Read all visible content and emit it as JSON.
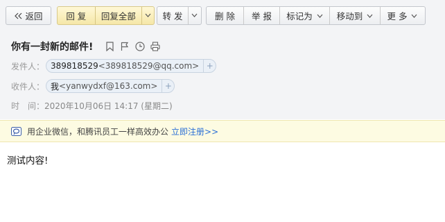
{
  "toolbar": {
    "back": "返回",
    "reply": "回 复",
    "reply_all": "回复全部",
    "forward": "转 发",
    "delete": "删 除",
    "report": "举 报",
    "mark_as": "标记为",
    "move_to": "移动到",
    "more": "更 多"
  },
  "mail": {
    "subject": "你有一封新的邮件!",
    "sender_label": "发件人：",
    "sender_name": "389818529",
    "sender_addr": "<389818529@qq.com>",
    "recipient_label": "收件人：",
    "recipient_name": "我",
    "recipient_addr": "<yanwydxf@163.com>",
    "time_label": "时　间：",
    "time_value": "2020年10月06日 14:17 (星期二)"
  },
  "promo": {
    "text": "用企业微信，和腾讯员工一样高效办公",
    "link": "立即注册>>"
  },
  "body": {
    "text": "测试内容!"
  },
  "icons": {
    "bookmark": "bookmark-icon",
    "flag": "flag-icon",
    "clock": "clock-icon",
    "print": "print-icon",
    "wework": "wework-icon"
  }
}
